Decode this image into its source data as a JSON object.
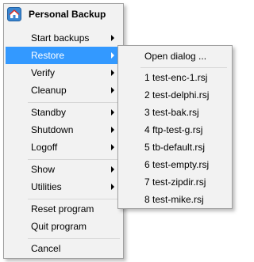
{
  "menu": {
    "title": "Personal Backup",
    "icon": "personal-backup-app-icon",
    "highlight_color": "#3399ff",
    "items": [
      {
        "label": "Start backups",
        "submenu": true
      },
      {
        "label": "Restore",
        "submenu": true,
        "active": true
      },
      {
        "label": "Verify",
        "submenu": true
      },
      {
        "label": "Cleanup",
        "submenu": true
      },
      {
        "label": "Standby",
        "submenu": true
      },
      {
        "label": "Shutdown",
        "submenu": true
      },
      {
        "label": "Logoff",
        "submenu": true
      },
      {
        "label": "Show",
        "submenu": true
      },
      {
        "label": "Utilities",
        "submenu": true
      },
      {
        "label": "Reset program",
        "submenu": false
      },
      {
        "label": "Quit program",
        "submenu": false
      },
      {
        "label": "Cancel",
        "submenu": false
      }
    ]
  },
  "submenu": {
    "parent": "Restore",
    "items": [
      {
        "label": "Open dialog ..."
      },
      {
        "label": "1 test-enc-1.rsj"
      },
      {
        "label": "2 test-delphi.rsj"
      },
      {
        "label": "3 test-bak.rsj"
      },
      {
        "label": "4 ftp-test-g.rsj"
      },
      {
        "label": "5 tb-default.rsj"
      },
      {
        "label": "6 test-empty.rsj"
      },
      {
        "label": "7 test-zipdir.rsj"
      },
      {
        "label": "8 test-mike.rsj"
      }
    ]
  }
}
